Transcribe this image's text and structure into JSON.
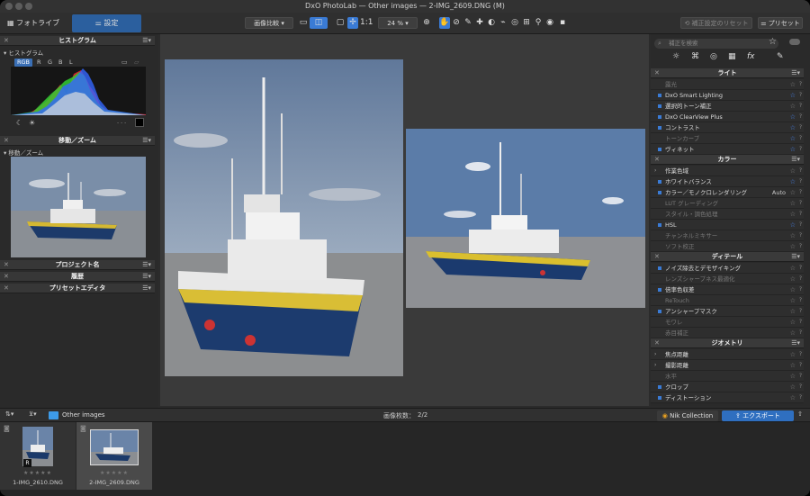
{
  "window": {
    "title": "DxO PhotoLab — Other images — 2-IMG_2609.DNG (M)"
  },
  "toolbar": {
    "tab_library": "フォトライブラリ",
    "tab_customize": "設定",
    "compare": "画像比較",
    "zoom_1to1": "1:1",
    "zoom_level": "24 %",
    "reset_label": "補正設定のリセット",
    "preset_label": "プリセット"
  },
  "left_panel": {
    "histogram": {
      "title": "ヒストグラム",
      "subtitle": "ヒストグラム",
      "channels": [
        "RGB",
        "R",
        "G",
        "B",
        "L"
      ],
      "active_channel": "RGB"
    },
    "move_zoom": {
      "title": "移動／ズーム",
      "subtitle": "移動／ズーム"
    },
    "collapsed": [
      "プロジェクト名",
      "履歴",
      "プリセットエディタ"
    ]
  },
  "right_panel": {
    "search_placeholder": "補正を検索",
    "sections": [
      {
        "title": "ライト",
        "items": [
          {
            "label": "露光",
            "dim": true,
            "marked": false,
            "starred": false
          },
          {
            "label": "DxO Smart Lighting",
            "dim": false,
            "marked": true,
            "starred": true
          },
          {
            "label": "選択的トーン補正",
            "dim": false,
            "marked": true,
            "starred": false
          },
          {
            "label": "DxO ClearView Plus",
            "dim": false,
            "marked": true,
            "starred": true
          },
          {
            "label": "コントラスト",
            "dim": false,
            "marked": true,
            "starred": true
          },
          {
            "label": "トーンカーブ",
            "dim": true,
            "marked": false,
            "starred": true
          },
          {
            "label": "ヴィネット",
            "dim": false,
            "marked": true,
            "starred": true
          }
        ]
      },
      {
        "title": "カラー",
        "items": [
          {
            "label": "作業色域",
            "dim": false,
            "marked": false,
            "chevron": true,
            "starred": false
          },
          {
            "label": "ホワイトバランス",
            "dim": false,
            "marked": true,
            "starred": true
          },
          {
            "label": "カラー／モノクロレンダリング",
            "dim": false,
            "marked": true,
            "starred": false,
            "value": "Auto"
          },
          {
            "label": "LUT グレーディング",
            "dim": true,
            "marked": false,
            "starred": false
          },
          {
            "label": "スタイル・調色処理",
            "dim": true,
            "marked": false,
            "starred": false
          },
          {
            "label": "HSL",
            "dim": false,
            "marked": true,
            "starred": true
          },
          {
            "label": "チャンネルミキサー",
            "dim": true,
            "marked": false,
            "starred": false
          },
          {
            "label": "ソフト校正",
            "dim": true,
            "marked": false,
            "starred": false
          }
        ]
      },
      {
        "title": "ディテール",
        "items": [
          {
            "label": "ノイズ除去とデモザイキング",
            "dim": false,
            "marked": true,
            "starred": false
          },
          {
            "label": "レンズシャープネス最適化",
            "dim": true,
            "marked": false,
            "starred": false
          },
          {
            "label": "倍率色収差",
            "dim": false,
            "marked": true,
            "starred": false
          },
          {
            "label": "ReTouch",
            "dim": true,
            "marked": false,
            "starred": false
          },
          {
            "label": "アンシャープマスク",
            "dim": false,
            "marked": true,
            "starred": false
          },
          {
            "label": "モワレ",
            "dim": true,
            "marked": false,
            "starred": false
          },
          {
            "label": "赤目補正",
            "dim": true,
            "marked": false,
            "starred": false
          }
        ]
      },
      {
        "title": "ジオメトリ",
        "items": [
          {
            "label": "焦点距離",
            "dim": false,
            "marked": false,
            "chevron": true,
            "starred": false
          },
          {
            "label": "撮影距離",
            "dim": false,
            "marked": false,
            "chevron": true,
            "starred": false
          },
          {
            "label": "水平",
            "dim": true,
            "marked": false,
            "starred": false
          },
          {
            "label": "クロップ",
            "dim": false,
            "marked": true,
            "starred": false
          },
          {
            "label": "ディストーション",
            "dim": false,
            "marked": true,
            "starred": false
          }
        ]
      }
    ]
  },
  "bottom": {
    "folder": "Other images",
    "count_label": "画像枚数：",
    "count_value": "2/2",
    "nik": "Nik Collection",
    "export": "エクスポート"
  },
  "filmstrip": [
    {
      "name": "1-IMG_2610.DNG",
      "selected": false
    },
    {
      "name": "2-IMG_2609.DNG",
      "selected": true
    }
  ],
  "colors": {
    "accent": "#2b5f9e",
    "blue": "#3a7bd5",
    "bg": "#2b2b2b"
  }
}
